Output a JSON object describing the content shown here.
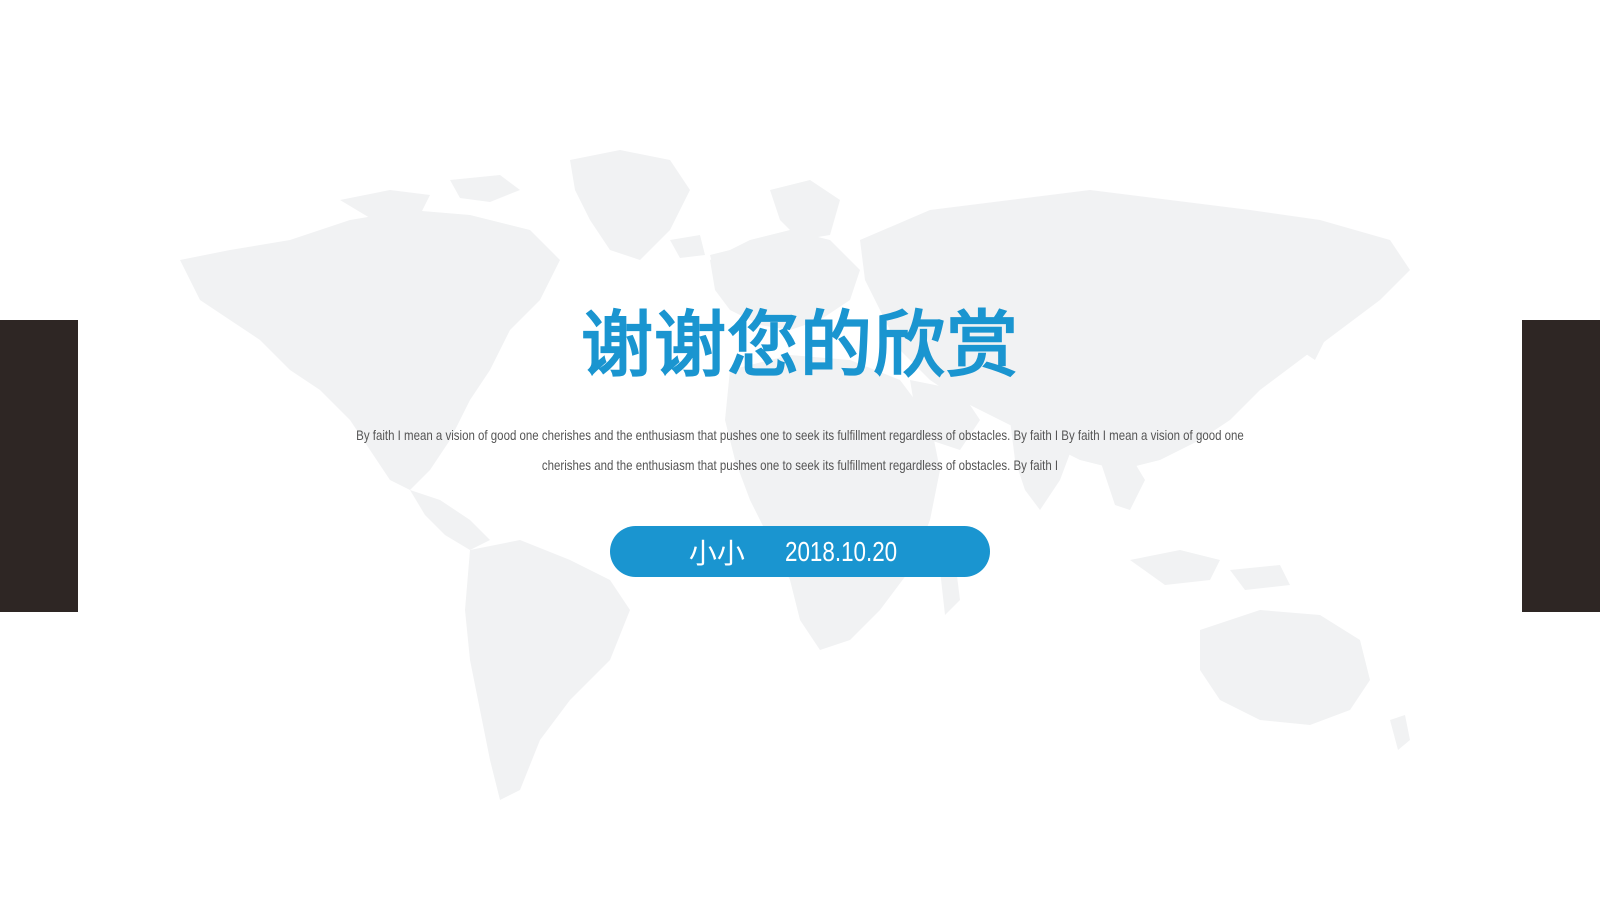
{
  "slide": {
    "title": "谢谢您的欣赏",
    "body": "By faith I mean a vision of good one cherishes and the enthusiasm that pushes one to seek its fulfillment regardless of obstacles. By faith I By faith I mean a vision of good one cherishes and the enthusiasm that pushes one to seek its fulfillment regardless of obstacles. By faith I",
    "author": "小小",
    "date": "2018.10.20"
  },
  "colors": {
    "accent": "#1a95d0",
    "side_bar": "#2e2624",
    "map": "#f1f2f3",
    "background": "#ffffff",
    "pill_text": "#ffffff"
  },
  "decor": {
    "background_map": "world-map"
  }
}
